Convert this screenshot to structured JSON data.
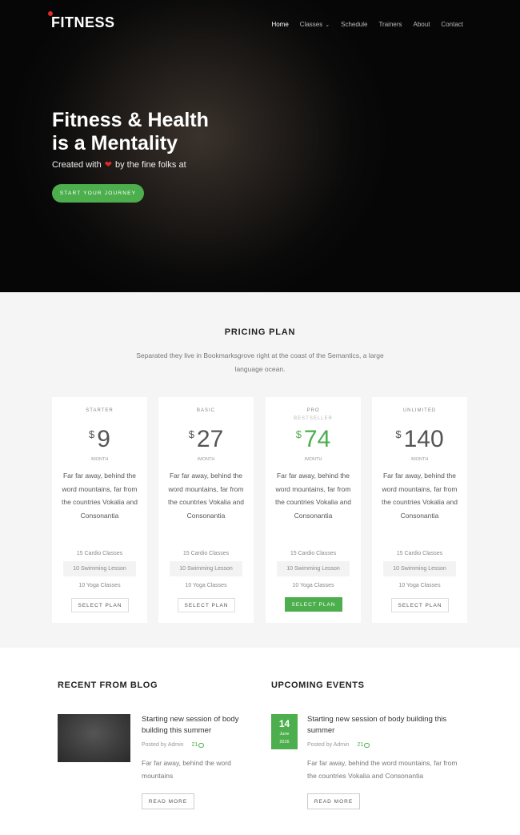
{
  "header": {
    "logo": "FITNESS",
    "nav": [
      {
        "label": "Home",
        "active": true,
        "dropdown": false
      },
      {
        "label": "Classes",
        "active": false,
        "dropdown": true
      },
      {
        "label": "Schedule",
        "active": false,
        "dropdown": false
      },
      {
        "label": "Trainers",
        "active": false,
        "dropdown": false
      },
      {
        "label": "About",
        "active": false,
        "dropdown": false
      },
      {
        "label": "Contact",
        "active": false,
        "dropdown": false
      }
    ]
  },
  "hero": {
    "title_line1": "Fitness & Health",
    "title_line2_pre": "is a ",
    "title_line2_bold": "Mentality",
    "subtitle_pre": "Created with",
    "subtitle_post": "by the fine folks at",
    "cta": "START YOUR JOURNEY"
  },
  "pricing": {
    "title": "PRICING PLAN",
    "description": "Separated they live in Bookmarksgrove right at the coast of the Semantics, a large language ocean.",
    "plans": [
      {
        "name": "STARTER",
        "tag": "",
        "currency": "$",
        "price": "9",
        "period": "/MONTH",
        "description": "Far far away, behind the word mountains, far from the countries Vokalia and Consonantia",
        "features": [
          "15 Cardio Classes",
          "10 Swimming Lesson",
          "10 Yoga Classes"
        ],
        "button": "SELECT PLAN"
      },
      {
        "name": "BASIC",
        "tag": "",
        "currency": "$",
        "price": "27",
        "period": "/MONTH",
        "description": "Far far away, behind the word mountains, far from the countries Vokalia and Consonantia",
        "features": [
          "15 Cardio Classes",
          "10 Swimming Lesson",
          "10 Yoga Classes"
        ],
        "button": "SELECT PLAN"
      },
      {
        "name": "PRO",
        "tag": "BESTSELLER",
        "currency": "$",
        "price": "74",
        "period": "/MONTH",
        "description": "Far far away, behind the word mountains, far from the countries Vokalia and Consonantia",
        "features": [
          "15 Cardio Classes",
          "10 Swimming Lesson",
          "10 Yoga Classes"
        ],
        "button": "SELECT PLAN"
      },
      {
        "name": "UNLIMITED",
        "tag": "",
        "currency": "$",
        "price": "140",
        "period": "/MONTH",
        "description": "Far far away, behind the word mountains, far from the countries Vokalia and Consonantia",
        "features": [
          "15 Cardio Classes",
          "10 Swimming Lesson",
          "10 Yoga Classes"
        ],
        "button": "SELECT PLAN"
      }
    ]
  },
  "blog": {
    "title": "RECENT FROM BLOG",
    "post_title": "Starting new session of body building this summer",
    "meta_author": "Posted by  Admin",
    "meta_comments": "21",
    "text": "Far far away, behind the word mountains",
    "button": "READ MORE"
  },
  "events": {
    "title": "UPCOMING EVENTS",
    "date_day": "14",
    "date_month": "June",
    "date_year": "2016",
    "post_title": "Starting new session of body building this summer",
    "meta_author": "Posted by  Admin",
    "meta_comments": "21",
    "text": "Far far away, behind the word mountains, far from the countries Vokalia and Consonantia",
    "button": "READ MORE"
  },
  "colors": {
    "accent": "#4cae4c",
    "heart": "#e02a2a",
    "hero_bg": "#0a0a0a",
    "pricing_bg": "#f5f5f5"
  }
}
